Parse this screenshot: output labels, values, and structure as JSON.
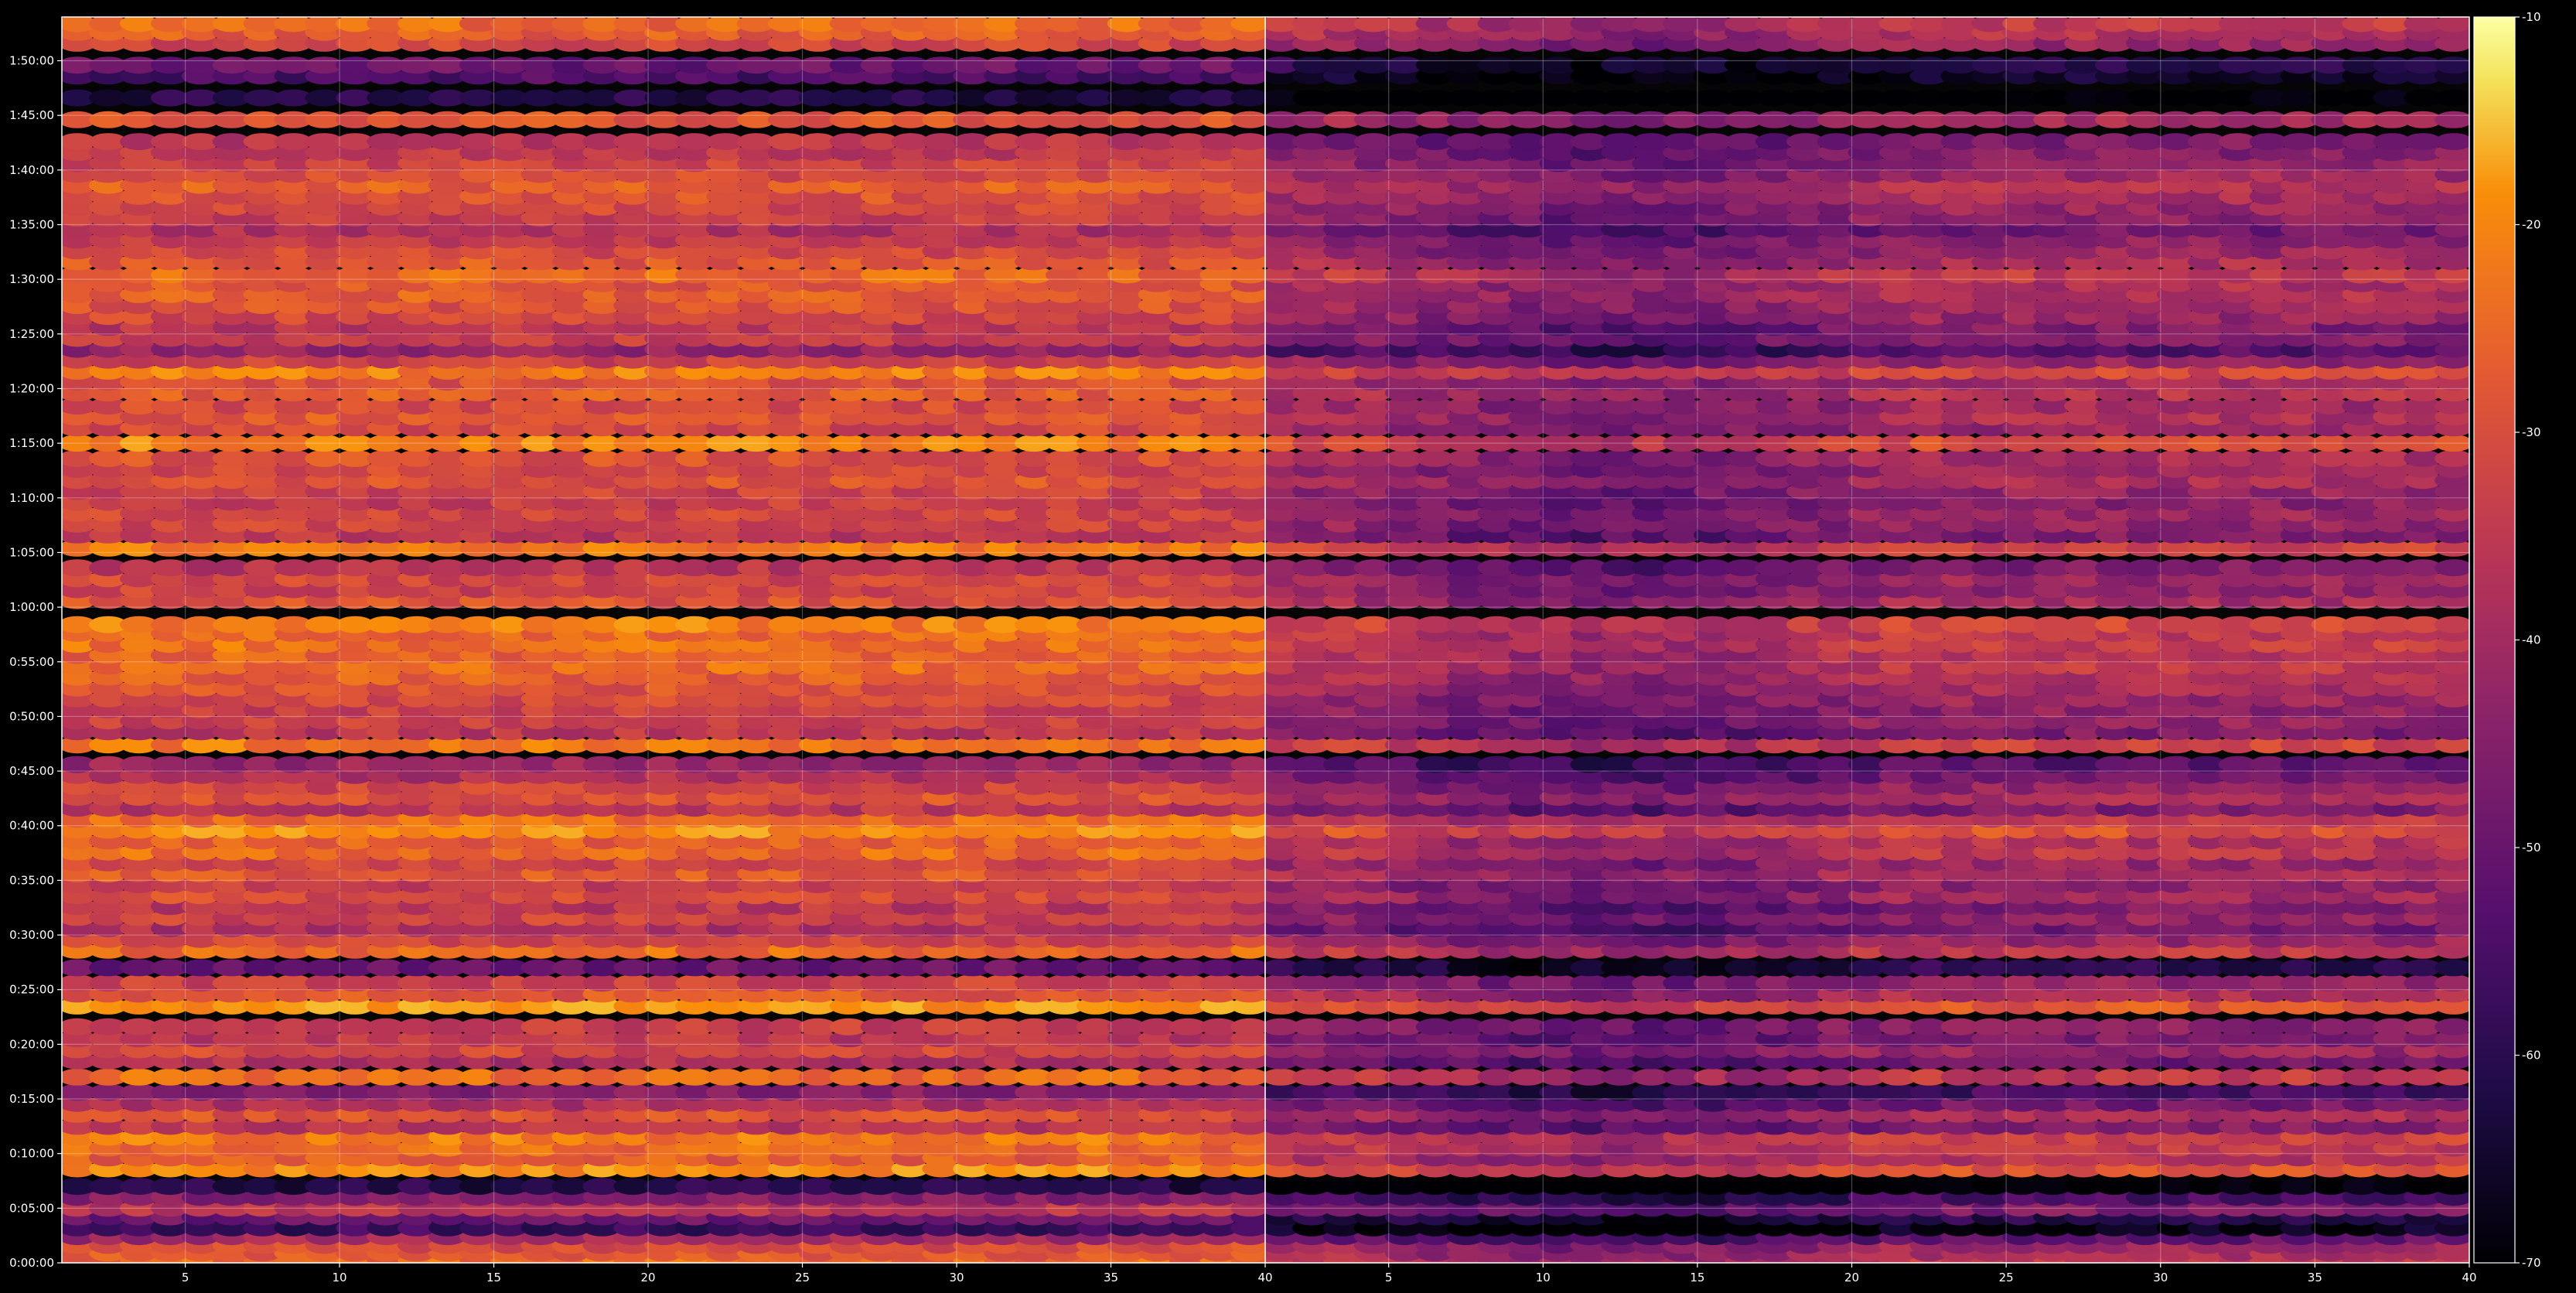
{
  "chart_data": [
    {
      "type": "heatmap",
      "panel": "left",
      "title": "",
      "xlabel": "",
      "ylabel": "",
      "x_ticks": [
        5,
        10,
        15,
        20,
        25,
        30,
        35,
        40
      ],
      "x_range": [
        1,
        40
      ],
      "columns": 39,
      "y_tick_labels": [
        "0:00:00",
        "0:05:00",
        "0:10:00",
        "0:15:00",
        "0:20:00",
        "0:25:00",
        "0:30:00",
        "0:35:00",
        "0:40:00",
        "0:45:00",
        "0:50:00",
        "0:55:00",
        "1:00:00",
        "1:05:00",
        "1:10:00",
        "1:15:00",
        "1:20:00",
        "1:25:00",
        "1:30:00",
        "1:35:00",
        "1:40:00",
        "1:45:00",
        "1:50:00"
      ],
      "y_range_minutes": [
        0,
        114
      ],
      "grid": true,
      "colormap": "inferno",
      "value_offset_db": 0
    },
    {
      "type": "heatmap",
      "panel": "right",
      "title": "",
      "xlabel": "",
      "ylabel": "",
      "x_ticks": [
        5,
        10,
        15,
        20,
        25,
        30,
        35,
        40
      ],
      "x_range": [
        1,
        40
      ],
      "columns": 39,
      "y_range_minutes": [
        0,
        114
      ],
      "grid": true,
      "colormap": "inferno",
      "value_offset_db": -9
    }
  ],
  "colorbar": {
    "ticks": [
      -10,
      -20,
      -30,
      -40,
      -50,
      -60,
      -70
    ],
    "range": [
      -70,
      -10
    ],
    "colormap": "inferno"
  },
  "rows": [
    {
      "t": 0.3,
      "v": -30
    },
    {
      "t": 0.9,
      "v": -33
    },
    {
      "t": 1.6,
      "v": -35
    },
    {
      "t": 2.4,
      "v": -44
    },
    {
      "t": 3.2,
      "v": -58
    },
    {
      "t": 4.2,
      "v": -52
    },
    {
      "t": 5.0,
      "v": -40
    },
    {
      "t": 6.0,
      "v": -48
    },
    {
      "t": 7.0,
      "v": -62
    },
    {
      "t": 8.6,
      "v": -25
    },
    {
      "t": 9.6,
      "v": -32
    },
    {
      "t": 10.5,
      "v": -30
    },
    {
      "t": 11.5,
      "v": -28
    },
    {
      "t": 12.5,
      "v": -40
    },
    {
      "t": 13.6,
      "v": -34
    },
    {
      "t": 14.6,
      "v": -42
    },
    {
      "t": 15.6,
      "v": -48
    },
    {
      "t": 17.0,
      "v": -30
    },
    {
      "t": 18.5,
      "v": -42
    },
    {
      "t": 19.5,
      "v": -36
    },
    {
      "t": 20.5,
      "v": -40
    },
    {
      "t": 21.6,
      "v": -38
    },
    {
      "t": 23.5,
      "v": -24
    },
    {
      "t": 24.6,
      "v": -33
    },
    {
      "t": 25.6,
      "v": -37
    },
    {
      "t": 27.0,
      "v": -52
    },
    {
      "t": 28.6,
      "v": -30
    },
    {
      "t": 29.6,
      "v": -36
    },
    {
      "t": 30.6,
      "v": -42
    },
    {
      "t": 31.6,
      "v": -37
    },
    {
      "t": 32.6,
      "v": -40
    },
    {
      "t": 33.6,
      "v": -35
    },
    {
      "t": 34.6,
      "v": -38
    },
    {
      "t": 35.6,
      "v": -33
    },
    {
      "t": 36.6,
      "v": -36
    },
    {
      "t": 37.6,
      "v": -30
    },
    {
      "t": 38.6,
      "v": -32
    },
    {
      "t": 39.6,
      "v": -25
    },
    {
      "t": 40.6,
      "v": -30
    },
    {
      "t": 41.6,
      "v": -40
    },
    {
      "t": 42.6,
      "v": -34
    },
    {
      "t": 43.6,
      "v": -37
    },
    {
      "t": 44.6,
      "v": -42
    },
    {
      "t": 45.6,
      "v": -45
    },
    {
      "t": 47.4,
      "v": -28
    },
    {
      "t": 48.6,
      "v": -40
    },
    {
      "t": 49.6,
      "v": -37
    },
    {
      "t": 50.6,
      "v": -38
    },
    {
      "t": 51.6,
      "v": -36
    },
    {
      "t": 52.6,
      "v": -34
    },
    {
      "t": 53.6,
      "v": -32
    },
    {
      "t": 54.6,
      "v": -30
    },
    {
      "t": 55.6,
      "v": -31
    },
    {
      "t": 56.6,
      "v": -29
    },
    {
      "t": 57.6,
      "v": -30
    },
    {
      "t": 58.4,
      "v": -27
    },
    {
      "t": 60.6,
      "v": -34
    },
    {
      "t": 61.6,
      "v": -37
    },
    {
      "t": 62.6,
      "v": -36
    },
    {
      "t": 63.6,
      "v": -40
    },
    {
      "t": 65.4,
      "v": -28
    },
    {
      "t": 66.6,
      "v": -40
    },
    {
      "t": 67.6,
      "v": -37
    },
    {
      "t": 68.6,
      "v": -36
    },
    {
      "t": 69.6,
      "v": -38
    },
    {
      "t": 70.6,
      "v": -37
    },
    {
      "t": 71.6,
      "v": -34
    },
    {
      "t": 72.6,
      "v": -36
    },
    {
      "t": 73.6,
      "v": -34
    },
    {
      "t": 75.0,
      "v": -26
    },
    {
      "t": 76.4,
      "v": -36
    },
    {
      "t": 77.4,
      "v": -33
    },
    {
      "t": 78.4,
      "v": -35
    },
    {
      "t": 79.6,
      "v": -32
    },
    {
      "t": 80.6,
      "v": -34
    },
    {
      "t": 81.6,
      "v": -27
    },
    {
      "t": 82.6,
      "v": -37
    },
    {
      "t": 83.6,
      "v": -46
    },
    {
      "t": 84.6,
      "v": -38
    },
    {
      "t": 85.6,
      "v": -40
    },
    {
      "t": 86.6,
      "v": -36
    },
    {
      "t": 87.6,
      "v": -34
    },
    {
      "t": 88.6,
      "v": -32
    },
    {
      "t": 89.6,
      "v": -33
    },
    {
      "t": 90.4,
      "v": -30
    },
    {
      "t": 91.6,
      "v": -33
    },
    {
      "t": 92.6,
      "v": -36
    },
    {
      "t": 93.6,
      "v": -38
    },
    {
      "t": 94.6,
      "v": -42
    },
    {
      "t": 95.6,
      "v": -38
    },
    {
      "t": 96.6,
      "v": -36
    },
    {
      "t": 97.6,
      "v": -34
    },
    {
      "t": 98.6,
      "v": -32
    },
    {
      "t": 99.6,
      "v": -35
    },
    {
      "t": 100.6,
      "v": -37
    },
    {
      "t": 101.6,
      "v": -39
    },
    {
      "t": 102.6,
      "v": -40
    },
    {
      "t": 104.6,
      "v": -34
    },
    {
      "t": 106.6,
      "v": -62
    },
    {
      "t": 108.6,
      "v": -56
    },
    {
      "t": 109.6,
      "v": -52
    },
    {
      "t": 111.6,
      "v": -36
    },
    {
      "t": 112.6,
      "v": -32
    },
    {
      "t": 113.4,
      "v": -30
    }
  ]
}
